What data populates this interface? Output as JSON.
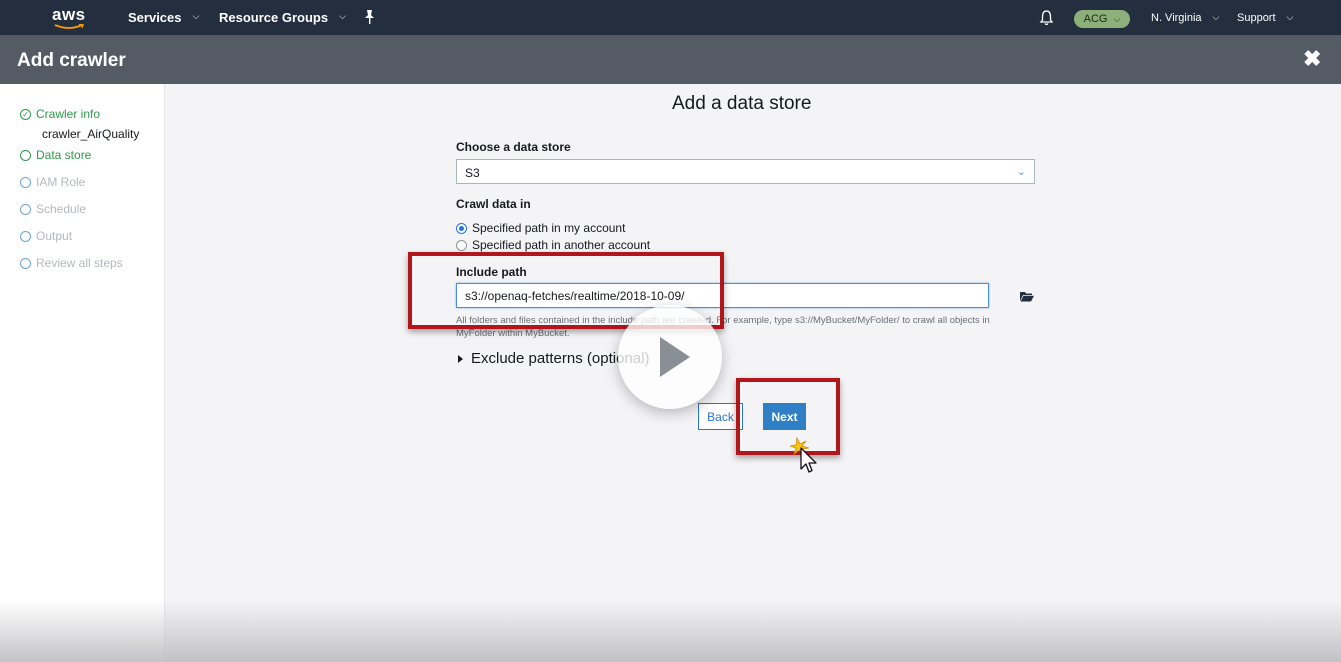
{
  "topnav": {
    "logo": "aws",
    "services": "Services",
    "resource_groups": "Resource Groups",
    "pin_icon": "pin-icon",
    "bell_icon": "bell-icon",
    "account": "ACG",
    "region": "N. Virginia",
    "support": "Support"
  },
  "header": {
    "title": "Add crawler",
    "close_icon": "close-icon"
  },
  "sidebar": {
    "steps": [
      {
        "label": "Crawler info",
        "state": "done"
      },
      {
        "label": "Data store",
        "state": "active"
      },
      {
        "label": "IAM Role",
        "state": "pending"
      },
      {
        "label": "Schedule",
        "state": "pending"
      },
      {
        "label": "Output",
        "state": "pending"
      },
      {
        "label": "Review all steps",
        "state": "pending"
      }
    ],
    "crawler_name": "crawler_AirQuality"
  },
  "main": {
    "title": "Add a data store",
    "data_store_label": "Choose a data store",
    "data_store_value": "S3",
    "crawl_data_label": "Crawl data in",
    "radio_options": [
      {
        "label": "Specified path in my account",
        "selected": true
      },
      {
        "label": "Specified path in another account",
        "selected": false
      }
    ],
    "include_path_label": "Include path",
    "include_path_value": "s3://openaq-fetches/realtime/2018-10-09/",
    "help_text": "All folders and files contained in the include path are crawled. For example, type s3://MyBucket/MyFolder/ to crawl all objects in MyFolder within MyBucket.",
    "exclude_label": "Exclude patterns (optional)",
    "back_label": "Back",
    "next_label": "Next"
  },
  "overlay": {
    "play_icon": "play-icon",
    "cursor_icon": "cursor-click-icon",
    "highlight_color": "#b0161c"
  }
}
